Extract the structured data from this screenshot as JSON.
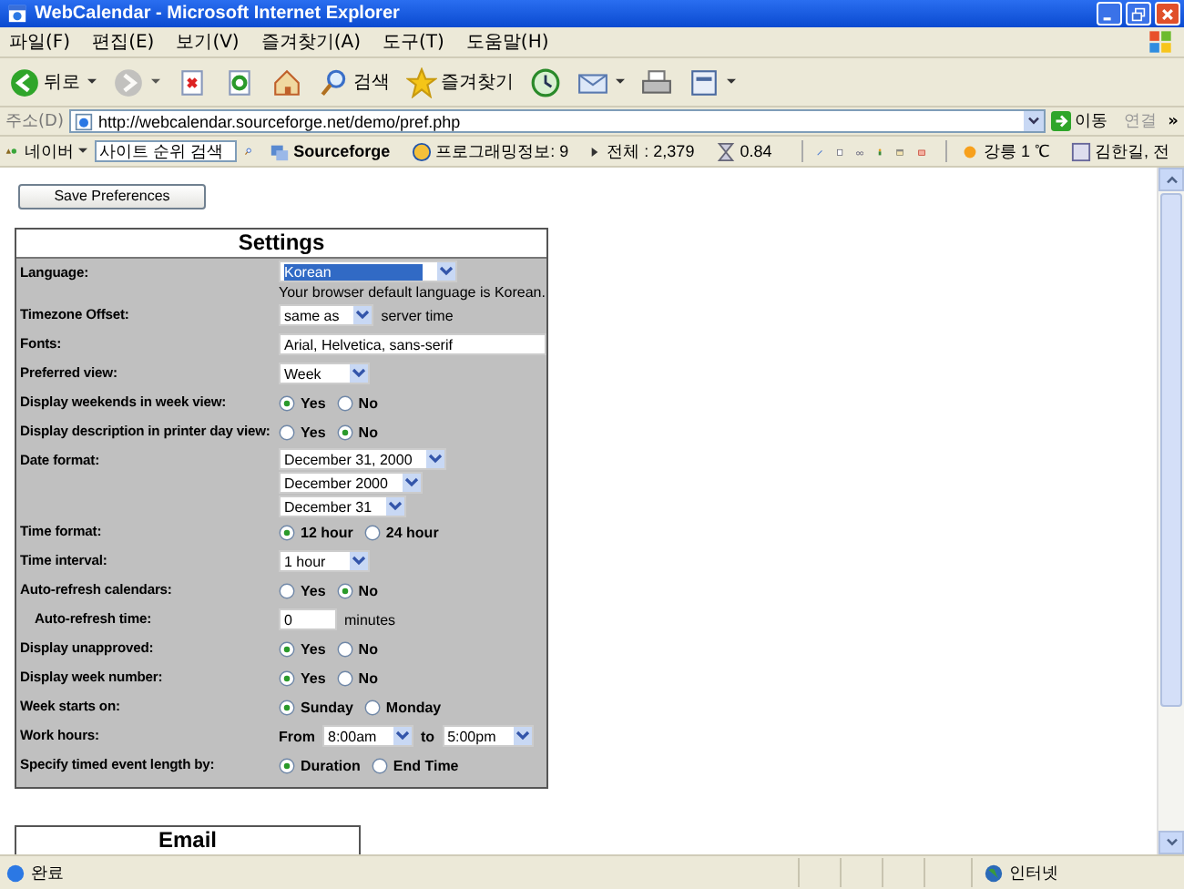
{
  "window": {
    "title": "WebCalendar - Microsoft Internet Explorer"
  },
  "menu": [
    "파일(F)",
    "편집(E)",
    "보기(V)",
    "즐겨찾기(A)",
    "도구(T)",
    "도움말(H)"
  ],
  "toolbar": [
    {
      "kind": "back",
      "label": "뒤로",
      "dropdown": true,
      "disabled": false
    },
    {
      "kind": "forward",
      "dropdown": true,
      "disabled": true
    },
    {
      "kind": "stop",
      "dropdown": false,
      "disabled": false
    },
    {
      "kind": "refresh",
      "dropdown": false,
      "disabled": false
    },
    {
      "kind": "home",
      "dropdown": false,
      "disabled": false
    },
    {
      "kind": "search",
      "label": "검색",
      "dropdown": false,
      "disabled": false
    },
    {
      "kind": "favorites",
      "label": "즐겨찾기",
      "dropdown": false,
      "disabled": false
    },
    {
      "kind": "history",
      "dropdown": false,
      "disabled": false
    },
    {
      "kind": "mail",
      "dropdown": true,
      "disabled": false
    },
    {
      "kind": "print",
      "dropdown": false,
      "disabled": false
    },
    {
      "kind": "edit",
      "dropdown": true,
      "disabled": false
    }
  ],
  "address": {
    "label": "주소(D)",
    "url": "http://webcalendar.sourceforge.net/demo/pref.php",
    "go": "이동",
    "links": "연결",
    "more": "»"
  },
  "links_bar": {
    "brand": "네이버",
    "search": "사이트 순위 검색",
    "items": [
      {
        "kind": "sourceforge",
        "label": "Sourceforge"
      },
      {
        "kind": "info",
        "label": "프로그래밍정보: 9"
      },
      {
        "kind": "total",
        "label": "전체 : 2,379"
      },
      {
        "kind": "timer",
        "label": "0.84"
      },
      {
        "kind": "tools"
      },
      {
        "kind": "weather",
        "label": "강릉 1 ℃"
      },
      {
        "kind": "contact",
        "label": "김한길, 전"
      }
    ]
  },
  "page": {
    "save_button": "Save Preferences",
    "settings": {
      "title": "Settings",
      "rows": [
        {
          "label": "Language:",
          "sub": false,
          "stacked": true,
          "controls": [
            {
              "kind": "select",
              "value": "Korean",
              "highlighted": true
            },
            {
              "kind": "note",
              "text": "Your browser default language is Korean."
            }
          ]
        },
        {
          "label": "Timezone Offset:",
          "sub": false,
          "controls": [
            {
              "kind": "select",
              "value": "same as",
              "highlighted": false
            },
            {
              "kind": "note",
              "text": "server time"
            }
          ]
        },
        {
          "label": "Fonts:",
          "sub": false,
          "controls": [
            {
              "kind": "text",
              "value": "Arial, Helvetica, sans-serif"
            }
          ]
        },
        {
          "label": "Preferred view:",
          "sub": false,
          "controls": [
            {
              "kind": "select",
              "value": "Week",
              "highlighted": false
            }
          ]
        },
        {
          "label": "Display weekends in week view:",
          "sub": false,
          "controls": [
            {
              "kind": "radio",
              "label": "Yes",
              "selected": true
            },
            {
              "kind": "radio",
              "label": "No",
              "selected": false
            }
          ]
        },
        {
          "label": "Display description in printer day view:",
          "sub": false,
          "controls": [
            {
              "kind": "radio",
              "label": "Yes",
              "selected": false
            },
            {
              "kind": "radio",
              "label": "No",
              "selected": true
            }
          ]
        },
        {
          "label": "Date format:",
          "sub": false,
          "stacked": true,
          "controls": [
            {
              "kind": "select",
              "value": "December 31, 2000",
              "highlighted": false
            },
            {
              "kind": "select",
              "value": "December 2000",
              "highlighted": false
            },
            {
              "kind": "select",
              "value": "December 31",
              "highlighted": false
            }
          ]
        },
        {
          "label": "Time format:",
          "sub": false,
          "controls": [
            {
              "kind": "radio",
              "label": "12 hour",
              "selected": true
            },
            {
              "kind": "radio",
              "label": "24 hour",
              "selected": false
            }
          ]
        },
        {
          "label": "Time interval:",
          "sub": false,
          "controls": [
            {
              "kind": "select",
              "value": "1 hour",
              "highlighted": false
            }
          ]
        },
        {
          "label": "Auto-refresh calendars:",
          "sub": false,
          "controls": [
            {
              "kind": "radio",
              "label": "Yes",
              "selected": false
            },
            {
              "kind": "radio",
              "label": "No",
              "selected": true
            }
          ]
        },
        {
          "label": "Auto-refresh time:",
          "sub": true,
          "controls": [
            {
              "kind": "number",
              "value": "0"
            },
            {
              "kind": "note",
              "text": "minutes"
            }
          ]
        },
        {
          "label": "Display unapproved:",
          "sub": false,
          "controls": [
            {
              "kind": "radio",
              "label": "Yes",
              "selected": true
            },
            {
              "kind": "radio",
              "label": "No",
              "selected": false
            }
          ]
        },
        {
          "label": "Display week number:",
          "sub": false,
          "controls": [
            {
              "kind": "radio",
              "label": "Yes",
              "selected": true
            },
            {
              "kind": "radio",
              "label": "No",
              "selected": false
            }
          ]
        },
        {
          "label": "Week starts on:",
          "sub": false,
          "controls": [
            {
              "kind": "radio",
              "label": "Sunday",
              "selected": true
            },
            {
              "kind": "radio",
              "label": "Monday",
              "selected": false
            }
          ]
        },
        {
          "label": "Work hours:",
          "sub": false,
          "controls": [
            {
              "kind": "word",
              "text": "From"
            },
            {
              "kind": "select",
              "value": "8:00am",
              "highlighted": false
            },
            {
              "kind": "word",
              "text": "to"
            },
            {
              "kind": "select",
              "value": "5:00pm",
              "highlighted": false
            }
          ]
        },
        {
          "label": "Specify timed event length by:",
          "sub": false,
          "controls": [
            {
              "kind": "radio",
              "label": "Duration",
              "selected": true
            },
            {
              "kind": "radio",
              "label": "End Time",
              "selected": false
            }
          ]
        }
      ]
    },
    "email": {
      "title": "Email"
    }
  },
  "status_bar": {
    "text": "완료",
    "zone": "인터넷"
  }
}
